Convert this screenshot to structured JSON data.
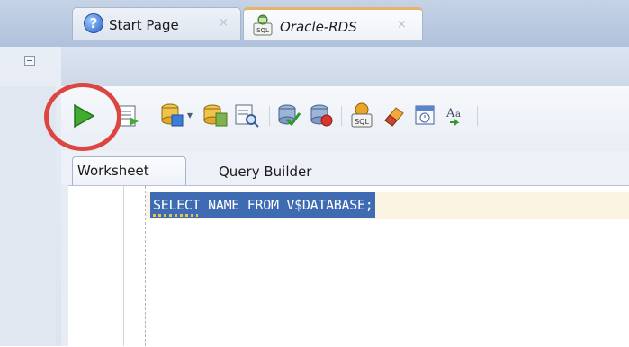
{
  "tabs": [
    {
      "label": "Start Page",
      "close": "×",
      "icon": "help-icon"
    },
    {
      "label": "Oracle-RDS",
      "close": "×",
      "icon": "sql-file-icon"
    }
  ],
  "toolbar": {
    "buttons": [
      "run-statement-icon",
      "run-script-icon",
      "commit-icon",
      "dropdown-arrow-icon",
      "autotrace-icon",
      "explain-plan-icon",
      "rollback-icon",
      "rollback-cancel-icon",
      "sql-tuning-icon",
      "clear-eraser-icon",
      "sql-history-icon",
      "to-upper-lower-icon"
    ],
    "dropdown_glyph": "▾"
  },
  "subtabs": {
    "worksheet": "Worksheet",
    "query_builder": "Query Builder"
  },
  "editor": {
    "code": "SELECT NAME FROM V$DATABASE;"
  },
  "colors": {
    "selection": "#3e6bb2",
    "annotation_circle": "#dd4640",
    "active_tab_accent": "#e7b36c"
  }
}
